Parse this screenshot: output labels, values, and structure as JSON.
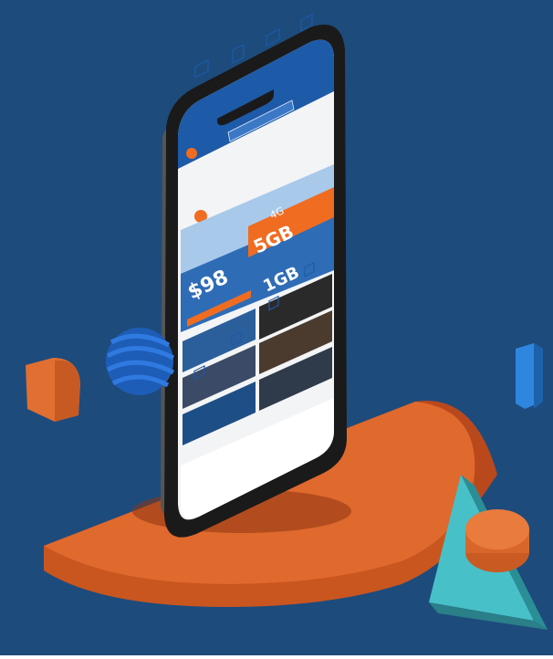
{
  "scene": {
    "background_color": "#1f4f82",
    "pedestal_color": "#d9622b",
    "accent_colors": [
      "#e6732f",
      "#2b7fd6",
      "#3fb8c4",
      "#1e66c0"
    ]
  },
  "phone": {
    "frame_color": "#1a1a1a",
    "app_header_color": "#1d5aa8",
    "banner_orange": "#ef6c21",
    "banner_price": "$98",
    "banner_data_big": "5GB",
    "banner_data_small": "1GB",
    "banner_network": "4G",
    "icons": [
      {
        "icon": "home-icon"
      },
      {
        "icon": "document-icon"
      },
      {
        "icon": "chat-icon"
      },
      {
        "icon": "phone-icon"
      },
      {
        "icon": "network-icon"
      },
      {
        "icon": "grid-icon"
      },
      {
        "icon": "badge-icon"
      }
    ],
    "bottom_nav": [
      {
        "icon": "home-icon"
      },
      {
        "icon": "list-icon"
      },
      {
        "icon": "gift-icon"
      },
      {
        "icon": "profile-icon"
      }
    ]
  }
}
